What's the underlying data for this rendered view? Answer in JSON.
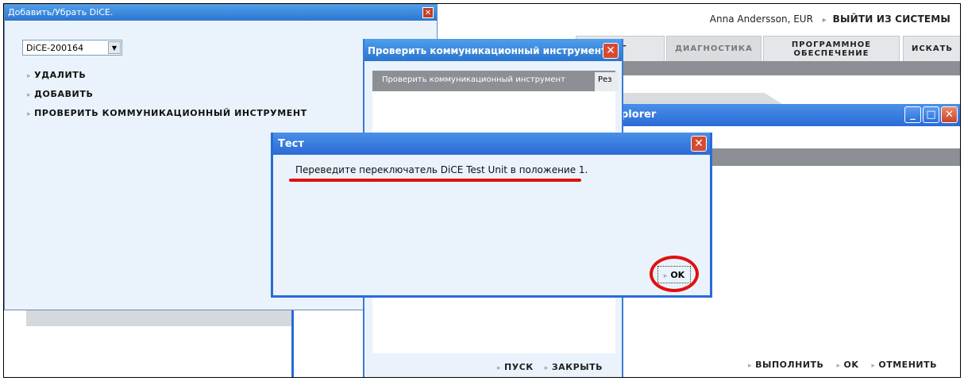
{
  "header": {
    "user": "Anna Andersson, EUR",
    "logout": "ВЫЙТИ ИЗ СИСТЕМЫ"
  },
  "tabs": [
    {
      "label": "ОГ"
    },
    {
      "label": "ДИАГНОСТИКА"
    },
    {
      "label": "ПРОГРАММНОЕ ОБЕСПЕЧЕНИЕ"
    },
    {
      "label": "ИСКАТЬ"
    }
  ],
  "explorer": {
    "title": "plorer",
    "footer": {
      "run": "ВЫПОЛНИТЬ",
      "ok": "OK",
      "cancel": "ОТМЕНИТЬ"
    }
  },
  "left_window": {
    "title": "Добавить/Убрать DiCE.",
    "close": "✕",
    "select_value": "DiCE-200164",
    "menu": {
      "remove": "УДАЛИТЬ",
      "add": "ДОБАВИТЬ",
      "check": "ПРОВЕРИТЬ КОММУНИКАЦИОННЫЙ ИНСТРУМЕНТ"
    }
  },
  "mid_window": {
    "title": "Проверить коммуникационный инструмент",
    "close": "✕",
    "tab_active": "Проверить коммуникационный инструмент",
    "tab_next": "Рез",
    "footer": {
      "start": "ПУСК",
      "close": "ЗАКРЫТЬ"
    }
  },
  "dialog": {
    "title": "Тест",
    "close": "✕",
    "message": "Переведите переключатель DiCE Test Unit в положение 1.",
    "ok": "OK"
  },
  "icons": {
    "window_minimize": "minimize-icon",
    "window_maximize": "maximize-icon",
    "window_close": "close-icon",
    "arrow": "arrow-right-icon"
  },
  "colors": {
    "titlebar": "#2a6bd6",
    "annotation": "#e01010",
    "window_bg": "#eaf3fb"
  }
}
